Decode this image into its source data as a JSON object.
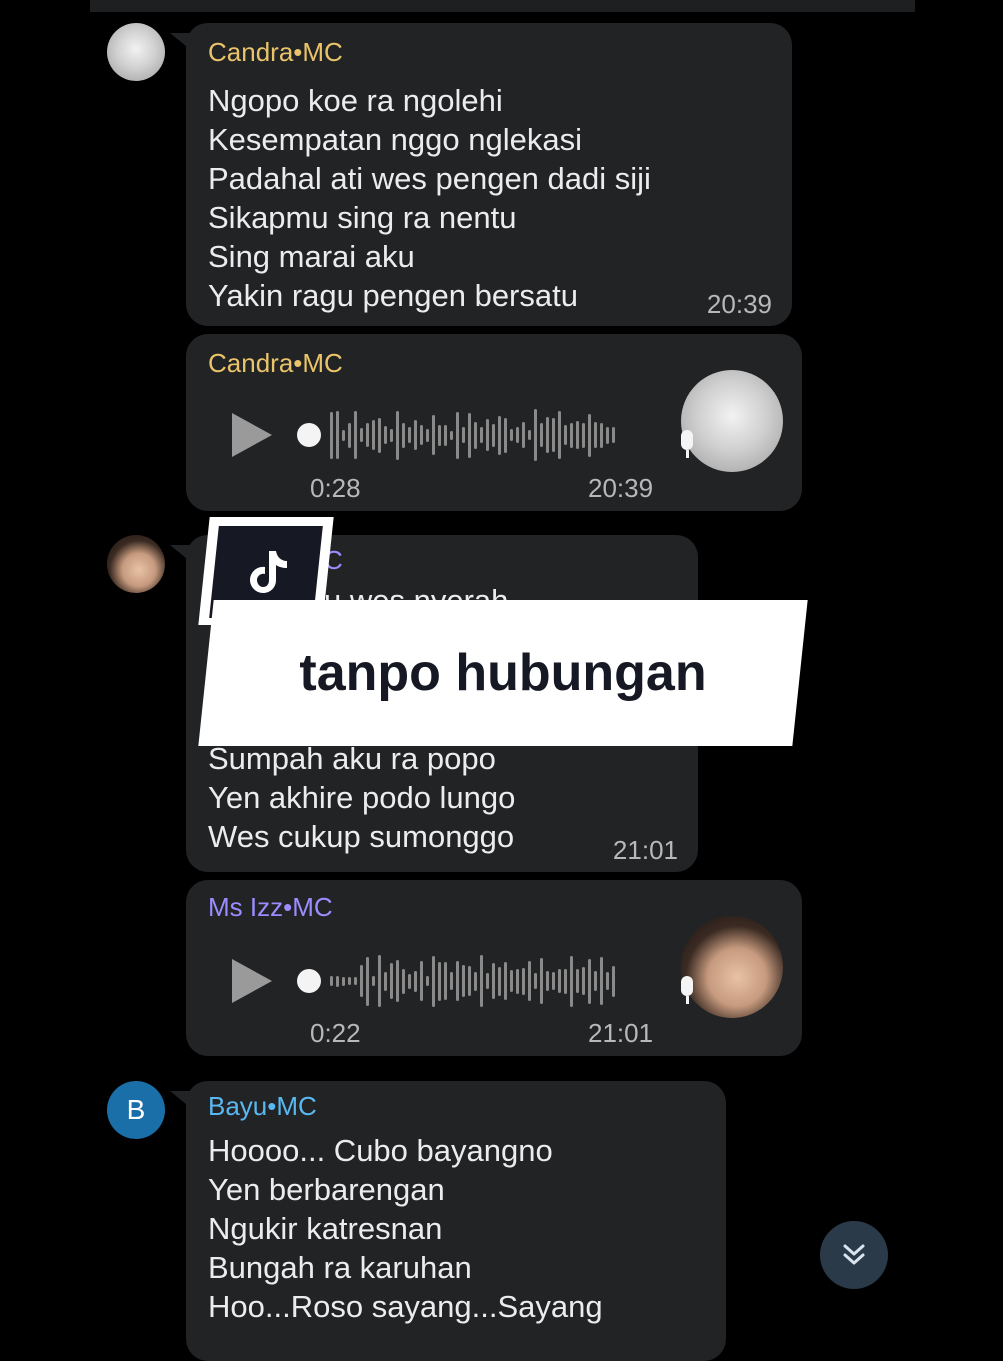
{
  "colors": {
    "bubble_bg": "#222325",
    "sender_candra": "#e9c46a",
    "sender_izz": "#9b8cff",
    "sender_bayu": "#5ab8f0",
    "text": "#ececec",
    "meta": "#b8b8b8"
  },
  "messages": [
    {
      "sender": "Candra•MC",
      "text": "Ngopo koe ra ngolehi\nKesempatan nggo nglekasi\nPadahal ati wes pengen dadi siji\nSikapmu sing ra nentu\nSing marai aku\nYakin ragu pengen bersatu",
      "time": "20:39"
    },
    {
      "sender": "Candra•MC",
      "voice_duration": "0:28",
      "time": "20:39",
      "play_icon": "play-icon",
      "mic_icon": "microphone-icon"
    },
    {
      "sender_partial": "C",
      "text_partial_top": "u wes nyerah",
      "text": "Sumpah aku ra popo\nYen akhire podo lungo\nWes cukup sumonggo",
      "time": "21:01"
    },
    {
      "sender": "Ms Izz•MC",
      "voice_duration": "0:22",
      "time": "21:01",
      "play_icon": "play-icon",
      "mic_icon": "microphone-icon"
    },
    {
      "sender": "Bayu•MC",
      "avatar_letter": "B",
      "text": "Hoooo... Cubo bayangno\nYen berbarengan\nNgukir katresnan\nBungah ra karuhan\nHoo...Roso sayang...Sayang"
    }
  ],
  "overlay": {
    "caption": "tanpo hubungan",
    "logo_icon": "tiktok-logo-icon"
  },
  "scroll_button_icon": "double-chevron-down-icon"
}
